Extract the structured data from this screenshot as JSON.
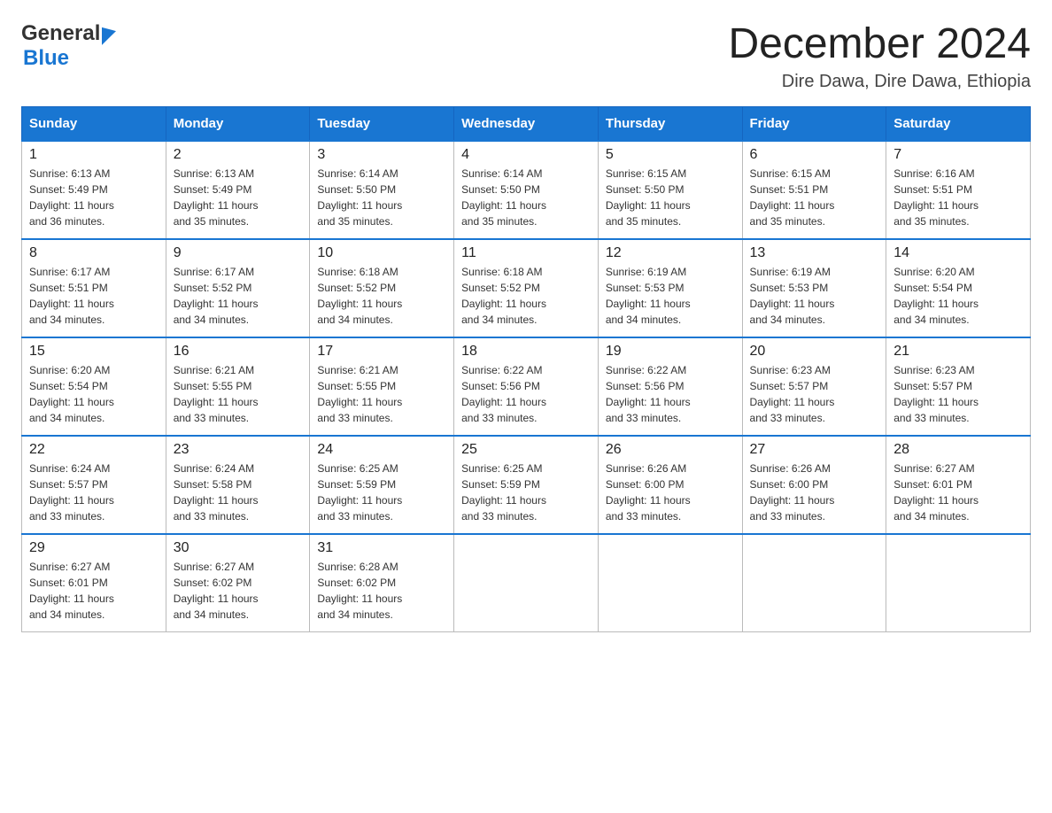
{
  "header": {
    "month_title": "December 2024",
    "location": "Dire Dawa, Dire Dawa, Ethiopia",
    "logo_general": "General",
    "logo_blue": "Blue"
  },
  "columns": [
    "Sunday",
    "Monday",
    "Tuesday",
    "Wednesday",
    "Thursday",
    "Friday",
    "Saturday"
  ],
  "weeks": [
    [
      {
        "day": "1",
        "sunrise": "6:13 AM",
        "sunset": "5:49 PM",
        "daylight": "11 hours and 36 minutes."
      },
      {
        "day": "2",
        "sunrise": "6:13 AM",
        "sunset": "5:49 PM",
        "daylight": "11 hours and 35 minutes."
      },
      {
        "day": "3",
        "sunrise": "6:14 AM",
        "sunset": "5:50 PM",
        "daylight": "11 hours and 35 minutes."
      },
      {
        "day": "4",
        "sunrise": "6:14 AM",
        "sunset": "5:50 PM",
        "daylight": "11 hours and 35 minutes."
      },
      {
        "day": "5",
        "sunrise": "6:15 AM",
        "sunset": "5:50 PM",
        "daylight": "11 hours and 35 minutes."
      },
      {
        "day": "6",
        "sunrise": "6:15 AM",
        "sunset": "5:51 PM",
        "daylight": "11 hours and 35 minutes."
      },
      {
        "day": "7",
        "sunrise": "6:16 AM",
        "sunset": "5:51 PM",
        "daylight": "11 hours and 35 minutes."
      }
    ],
    [
      {
        "day": "8",
        "sunrise": "6:17 AM",
        "sunset": "5:51 PM",
        "daylight": "11 hours and 34 minutes."
      },
      {
        "day": "9",
        "sunrise": "6:17 AM",
        "sunset": "5:52 PM",
        "daylight": "11 hours and 34 minutes."
      },
      {
        "day": "10",
        "sunrise": "6:18 AM",
        "sunset": "5:52 PM",
        "daylight": "11 hours and 34 minutes."
      },
      {
        "day": "11",
        "sunrise": "6:18 AM",
        "sunset": "5:52 PM",
        "daylight": "11 hours and 34 minutes."
      },
      {
        "day": "12",
        "sunrise": "6:19 AM",
        "sunset": "5:53 PM",
        "daylight": "11 hours and 34 minutes."
      },
      {
        "day": "13",
        "sunrise": "6:19 AM",
        "sunset": "5:53 PM",
        "daylight": "11 hours and 34 minutes."
      },
      {
        "day": "14",
        "sunrise": "6:20 AM",
        "sunset": "5:54 PM",
        "daylight": "11 hours and 34 minutes."
      }
    ],
    [
      {
        "day": "15",
        "sunrise": "6:20 AM",
        "sunset": "5:54 PM",
        "daylight": "11 hours and 34 minutes."
      },
      {
        "day": "16",
        "sunrise": "6:21 AM",
        "sunset": "5:55 PM",
        "daylight": "11 hours and 33 minutes."
      },
      {
        "day": "17",
        "sunrise": "6:21 AM",
        "sunset": "5:55 PM",
        "daylight": "11 hours and 33 minutes."
      },
      {
        "day": "18",
        "sunrise": "6:22 AM",
        "sunset": "5:56 PM",
        "daylight": "11 hours and 33 minutes."
      },
      {
        "day": "19",
        "sunrise": "6:22 AM",
        "sunset": "5:56 PM",
        "daylight": "11 hours and 33 minutes."
      },
      {
        "day": "20",
        "sunrise": "6:23 AM",
        "sunset": "5:57 PM",
        "daylight": "11 hours and 33 minutes."
      },
      {
        "day": "21",
        "sunrise": "6:23 AM",
        "sunset": "5:57 PM",
        "daylight": "11 hours and 33 minutes."
      }
    ],
    [
      {
        "day": "22",
        "sunrise": "6:24 AM",
        "sunset": "5:57 PM",
        "daylight": "11 hours and 33 minutes."
      },
      {
        "day": "23",
        "sunrise": "6:24 AM",
        "sunset": "5:58 PM",
        "daylight": "11 hours and 33 minutes."
      },
      {
        "day": "24",
        "sunrise": "6:25 AM",
        "sunset": "5:59 PM",
        "daylight": "11 hours and 33 minutes."
      },
      {
        "day": "25",
        "sunrise": "6:25 AM",
        "sunset": "5:59 PM",
        "daylight": "11 hours and 33 minutes."
      },
      {
        "day": "26",
        "sunrise": "6:26 AM",
        "sunset": "6:00 PM",
        "daylight": "11 hours and 33 minutes."
      },
      {
        "day": "27",
        "sunrise": "6:26 AM",
        "sunset": "6:00 PM",
        "daylight": "11 hours and 33 minutes."
      },
      {
        "day": "28",
        "sunrise": "6:27 AM",
        "sunset": "6:01 PM",
        "daylight": "11 hours and 34 minutes."
      }
    ],
    [
      {
        "day": "29",
        "sunrise": "6:27 AM",
        "sunset": "6:01 PM",
        "daylight": "11 hours and 34 minutes."
      },
      {
        "day": "30",
        "sunrise": "6:27 AM",
        "sunset": "6:02 PM",
        "daylight": "11 hours and 34 minutes."
      },
      {
        "day": "31",
        "sunrise": "6:28 AM",
        "sunset": "6:02 PM",
        "daylight": "11 hours and 34 minutes."
      },
      null,
      null,
      null,
      null
    ]
  ],
  "labels": {
    "sunrise": "Sunrise:",
    "sunset": "Sunset:",
    "daylight": "Daylight:"
  }
}
